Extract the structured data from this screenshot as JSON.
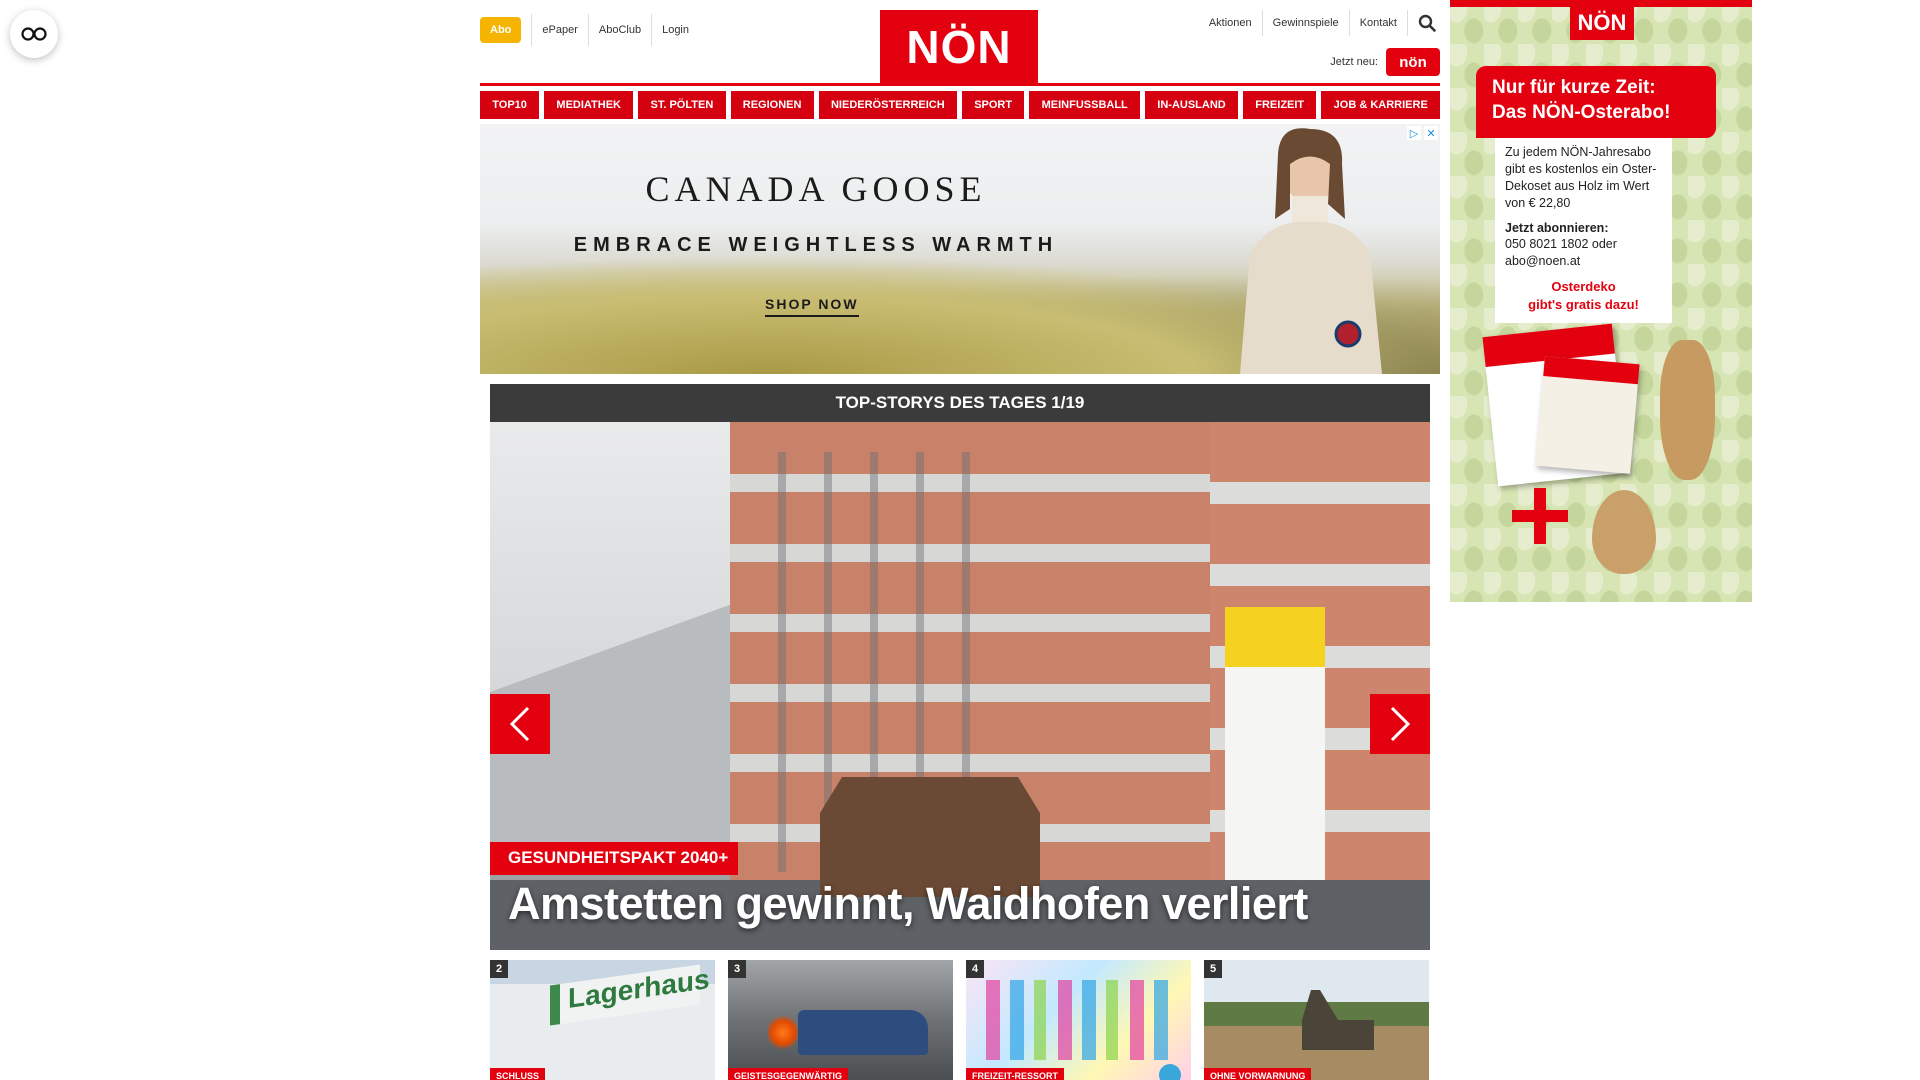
{
  "header": {
    "abo": "Abo",
    "left_links": [
      "ePaper",
      "AboClub",
      "Login"
    ],
    "logo": "NÖN",
    "right_links": [
      "Aktionen",
      "Gewinnspiele",
      "Kontakt"
    ],
    "jetzt_neu": "Jetzt neu:",
    "kleine_badge": "nön"
  },
  "nav": {
    "items": [
      "TOP10",
      "MEDIATHEK",
      "ST. PÖLTEN",
      "REGIONEN",
      "NIEDERÖSTERREICH",
      "SPORT",
      "MEINFUSSBALL",
      "IN-AUSLAND",
      "FREIZEIT",
      "JOB & KARRIERE"
    ]
  },
  "ad_banner": {
    "brand": "CANADA GOOSE",
    "tagline": "EMBRACE WEIGHTLESS WARMTH",
    "cta": "SHOP NOW"
  },
  "stories": {
    "title": "TOP-STORYS DES TAGES 1/19",
    "hero_tag": "GESUNDHEITSPAKT 2040+",
    "hero_title": "Amstetten gewinnt, Waidhofen verliert"
  },
  "thumbs": [
    {
      "num": "2",
      "tag": "SCHLUSS"
    },
    {
      "num": "3",
      "tag": "GEISTESGEGENWÄRTIG"
    },
    {
      "num": "4",
      "tag": "FREIZEIT-RESSORT"
    },
    {
      "num": "5",
      "tag": "OHNE VORWARNUNG"
    }
  ],
  "side_ad": {
    "logo": "NÖN",
    "headline_1": "Nur für kurze Zeit:",
    "headline_2": "Das NÖN-Osterabo!",
    "body": "Zu jedem NÖN-Jahresabo gibt es kostenlos ein Oster-Dekoset aus Holz im Wert von € 22,80",
    "subscribe_label": "Jetzt abonnieren:",
    "contact": "050 8021 1802 oder abo@noen.at",
    "promo_1": "Osterdeko",
    "promo_2": "gibt's gratis dazu!"
  },
  "colors": {
    "brand_red": "#e3000f",
    "abo_yellow": "#f5b400",
    "stories_bar": "#3b3b3b"
  }
}
